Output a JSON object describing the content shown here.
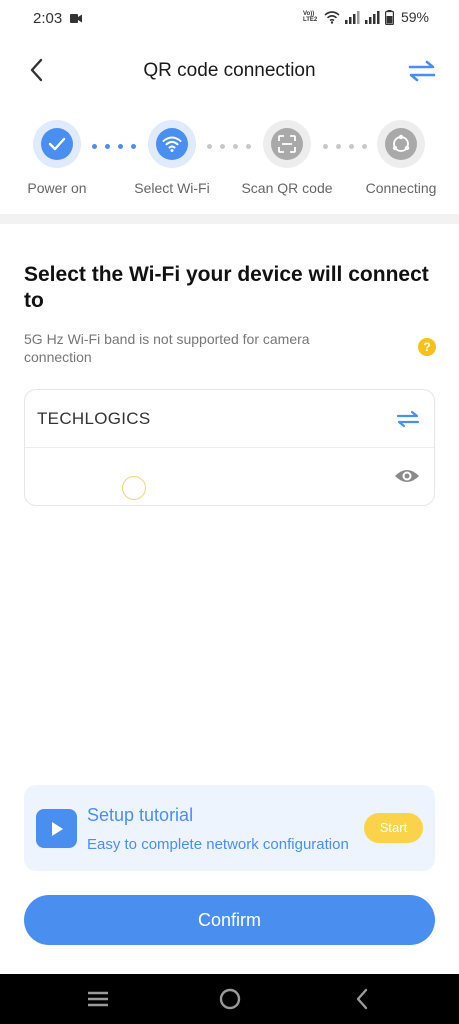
{
  "status_bar": {
    "time": "2:03",
    "volte_top": "Vo))",
    "volte_bottom": "LTE2",
    "battery_percent": "59%"
  },
  "header": {
    "title": "QR code connection"
  },
  "steps": [
    {
      "label": "Power on",
      "state": "completed",
      "icon": "check-icon"
    },
    {
      "label": "Select Wi-Fi",
      "state": "current",
      "icon": "wifi-icon"
    },
    {
      "label": "Scan QR code",
      "state": "pending",
      "icon": "scan-icon"
    },
    {
      "label": "Connecting",
      "state": "pending",
      "icon": "connecting-icon"
    }
  ],
  "main": {
    "heading": "Select the Wi-Fi your device will connect to",
    "note": "5G Hz Wi-Fi band is not supported for camera connection",
    "help_symbol": "?"
  },
  "wifi": {
    "ssid": "TECHLOGICS",
    "password_value": ""
  },
  "tutorial": {
    "title": "Setup tutorial",
    "subtitle": "Easy to complete network configuration",
    "start_label": "Start"
  },
  "confirm_label": "Confirm",
  "colors": {
    "accent": "#4a8fef",
    "warning": "#f5c21b",
    "start_button": "#fbd34a"
  }
}
